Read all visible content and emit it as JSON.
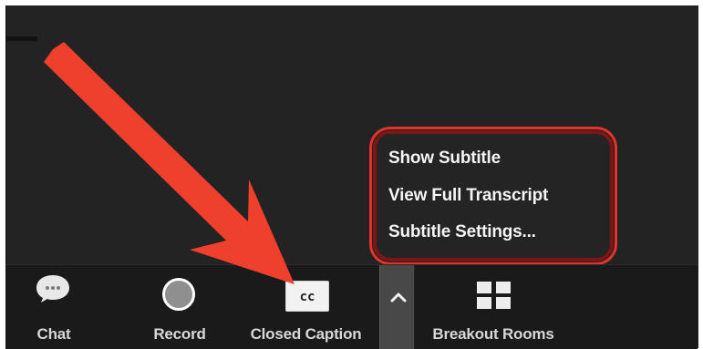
{
  "colors": {
    "background": "#232323",
    "toolbar": "#1a1a1a",
    "toolbar_text": "#d7d7d7",
    "menu_background": "#242424",
    "menu_text": "#f5f5f5",
    "highlight": "#e2332c",
    "annotation_arrow": "#ef3f2d"
  },
  "toolbar": {
    "buttons": [
      {
        "label": "Chat",
        "icon": "chat-icon"
      },
      {
        "label": "Record",
        "icon": "record-icon"
      },
      {
        "label": "Closed Caption",
        "icon": "closed-caption-icon",
        "icon_text": "cc"
      },
      {
        "label": "Breakout Rooms",
        "icon": "breakout-rooms-icon"
      }
    ],
    "caret_icon": "chevron-up-icon"
  },
  "caption_menu": {
    "items": [
      "Show Subtitle",
      "View Full Transcript",
      "Subtitle Settings..."
    ]
  },
  "annotation": {
    "arrow_icon": "red-arrow-icon",
    "highlight": "red-rounded-outline"
  }
}
